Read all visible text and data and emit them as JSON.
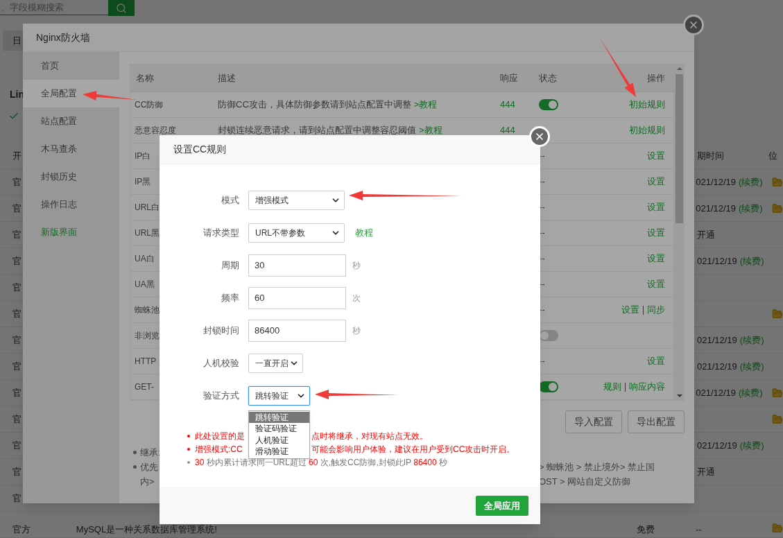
{
  "background": {
    "search": {
      "placeholder": "、字段模糊搜索"
    },
    "side_button": "日",
    "heading": "Lin",
    "rows": [
      {
        "cell_1": "开",
        "cell_4": "期时间",
        "cell_5": "位",
        "folder": false
      },
      {
        "cell_1": "官",
        "cell_4": "021/12/19",
        "renew": "(续费)",
        "folder": true
      },
      {
        "cell_1": "官",
        "cell_4": "021/12/19",
        "renew": "(续费)",
        "folder": true
      },
      {
        "cell_1": "官",
        "cell_4": "开通",
        "folder": false
      },
      {
        "cell_1": "官",
        "cell_4": "021/12/19",
        "renew": "(续费)",
        "folder": false
      },
      {
        "cell_1": "官",
        "folder": false
      },
      {
        "cell_1": "官",
        "folder": true
      },
      {
        "cell_1": "官",
        "cell_4": "021/12/19",
        "renew": "(续费)",
        "folder": false
      },
      {
        "cell_1": "官",
        "cell_4": "021/12/19",
        "renew": "(续费)",
        "folder": false
      },
      {
        "cell_1": "官",
        "cell_4": "021/12/19",
        "renew": "(续费)",
        "folder": true
      },
      {
        "cell_1": "官",
        "folder": true
      },
      {
        "cell_1": "官",
        "cell_4": "021/12/19",
        "renew": "(续费)",
        "folder": false
      },
      {
        "cell_1": "官",
        "cell_4": "开通",
        "folder": false
      },
      {
        "cell_1": "官",
        "folder": false
      },
      {
        "cell_1": "官方",
        "cell_2": "MySQL是一种关系数据库管理系统!",
        "cell_3": "免费",
        "cell_4": "--",
        "folder": true
      }
    ]
  },
  "firewall": {
    "title": "Nginx防火墙",
    "sidebar": [
      {
        "label": "首页",
        "selected": false,
        "kind": "item"
      },
      {
        "label": "全局配置",
        "selected": true,
        "kind": "item"
      },
      {
        "label": "站点配置",
        "selected": false,
        "kind": "item"
      },
      {
        "label": "木马查杀",
        "selected": false,
        "kind": "item"
      },
      {
        "label": "封锁历史",
        "selected": false,
        "kind": "item"
      },
      {
        "label": "操作日志",
        "selected": false,
        "kind": "item"
      },
      {
        "label": "新版界面",
        "selected": false,
        "kind": "link"
      }
    ],
    "table": {
      "columns": [
        "名称",
        "描述",
        "响应",
        "状态",
        "操作"
      ],
      "rows": [
        {
          "name": "CC防御",
          "description": "防御CC攻击，具体防御参数请到站点配置中调整",
          "link": ">教程",
          "response": "444",
          "status": {
            "kind": "toggle",
            "on": true
          },
          "actions": [
            "初始规则"
          ]
        },
        {
          "name": "恶意容忍度",
          "description": "封锁连续恶意请求，请到站点配置中调整容忍阈值",
          "link": ">教程",
          "response": "444",
          "actions": [
            "初始规则"
          ]
        },
        {
          "name": "IP白",
          "status": {
            "kind": "text",
            "text": "--"
          },
          "actions": [
            "设置"
          ]
        },
        {
          "name": "IP黑",
          "status": {
            "kind": "text",
            "text": "--"
          },
          "actions": [
            "设置"
          ]
        },
        {
          "name": "URL白",
          "status": {
            "kind": "text",
            "text": "--"
          },
          "actions": [
            "设置"
          ]
        },
        {
          "name": "URL黑",
          "status": {
            "kind": "text",
            "text": "--"
          },
          "actions": [
            "设置"
          ]
        },
        {
          "name": "UA白",
          "status": {
            "kind": "text",
            "text": "--"
          },
          "actions": [
            "设置"
          ]
        },
        {
          "name": "UA黑",
          "status": {
            "kind": "text",
            "text": "--"
          },
          "actions": [
            "设置"
          ]
        },
        {
          "name": "蜘蛛池",
          "status": {
            "kind": "text",
            "text": "--"
          },
          "actions": [
            "设置",
            "同步"
          ]
        },
        {
          "name": "非浏览",
          "status": {
            "kind": "toggle",
            "on": false
          }
        },
        {
          "name": "HTTP",
          "status": {
            "kind": "text",
            "text": "--"
          },
          "actions": [
            "设置"
          ]
        },
        {
          "name": "GET-",
          "status": {
            "kind": "toggle",
            "on": true
          },
          "actions": [
            "规则",
            "响应内容"
          ]
        }
      ]
    },
    "buttons": [
      "导入配置",
      "导出配置"
    ],
    "notes": [
      {
        "bullet": true,
        "left": "继承:"
      },
      {
        "bullet": true,
        "left": "优先",
        "right": "> 蜘蛛池 > 禁止境外> 禁止国"
      },
      {
        "bullet": false,
        "left": "内>",
        "right": "OST > 网站自定义防御"
      }
    ]
  },
  "cc_dialog": {
    "title": "设置CC规则",
    "fields": [
      {
        "label": "模式",
        "kind": "select",
        "value": "增强模式",
        "focused": false
      },
      {
        "label": "请求类型",
        "kind": "select",
        "value": "URL不带参数",
        "link": "教程",
        "focused": false
      },
      {
        "label": "周期",
        "kind": "input",
        "value": "30",
        "unit": "秒",
        "focused": false
      },
      {
        "label": "频率",
        "kind": "input",
        "value": "60",
        "unit": "次",
        "focused": false
      },
      {
        "label": "封锁时间",
        "kind": "input",
        "value": "86400",
        "unit": "秒",
        "focused": false
      },
      {
        "label": "人机校验",
        "kind": "select",
        "value": "一直开启",
        "focused": false
      },
      {
        "label": "验证方式",
        "kind": "select",
        "value": "跳转验证",
        "focused": true,
        "open": true,
        "options": [
          {
            "label": "跳转验证",
            "selected": true
          },
          {
            "label": "验证码验证",
            "selected": false
          },
          {
            "label": "人机验证",
            "selected": false
          },
          {
            "label": "滑动验证",
            "selected": false
          }
        ]
      }
    ],
    "notes": [
      {
        "kind": "warning",
        "parts": [
          "此处设置的是",
          "点时将继承，对现有站点无效。"
        ]
      },
      {
        "kind": "warning",
        "parts": [
          "增强模式:CC",
          "可能会影响用户体验，建议在用户受到CC攻击时开启。"
        ]
      },
      {
        "kind": "summary",
        "parts": [
          {
            "text": "30",
            "emphasis": true
          },
          {
            "text": " 秒内累计请求同一URL超过 ",
            "emphasis": false
          },
          {
            "text": "60",
            "emphasis": true
          },
          {
            "text": " 次,触发CC防御,封锁此IP ",
            "emphasis": false
          },
          {
            "text": "86400",
            "emphasis": true
          },
          {
            "text": " 秒",
            "emphasis": false
          }
        ]
      }
    ],
    "apply_button": "全局应用"
  }
}
